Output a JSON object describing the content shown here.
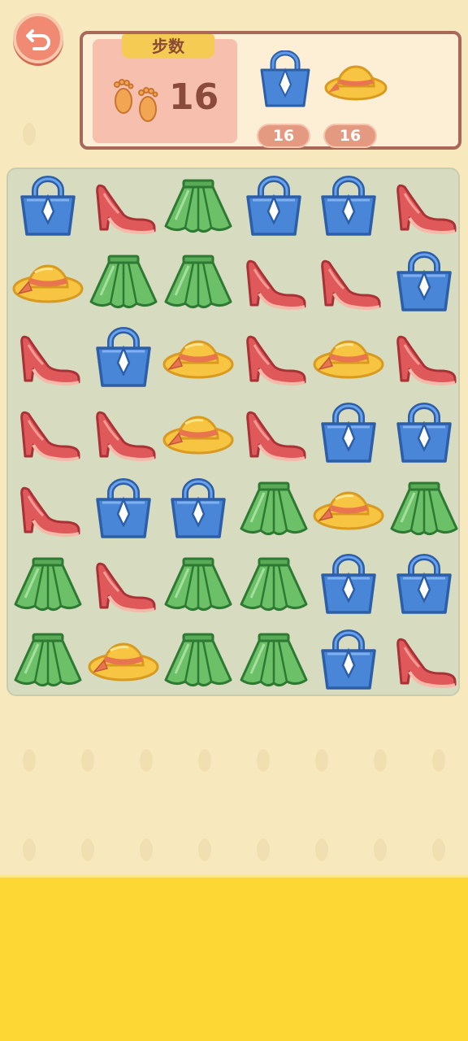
{
  "hud": {
    "steps_label": "步数",
    "steps_value": "16",
    "goals": [
      {
        "icon": "handbag-icon",
        "count": "16"
      },
      {
        "icon": "sun-hat-icon",
        "count": "16"
      }
    ]
  },
  "board": {
    "rows": 7,
    "cols": 6,
    "tiles": [
      [
        "bag",
        "heel",
        "skirt",
        "bag",
        "bag",
        "heel"
      ],
      [
        "hat",
        "skirt",
        "skirt",
        "heel",
        "heel",
        "bag"
      ],
      [
        "heel",
        "bag",
        "hat",
        "heel",
        "hat",
        "heel"
      ],
      [
        "heel",
        "heel",
        "hat",
        "heel",
        "bag",
        "bag"
      ],
      [
        "heel",
        "bag",
        "bag",
        "skirt",
        "hat",
        "skirt"
      ],
      [
        "skirt",
        "heel",
        "skirt",
        "skirt",
        "bag",
        "bag"
      ],
      [
        "skirt",
        "hat",
        "skirt",
        "skirt",
        "bag",
        "heel"
      ]
    ]
  },
  "colors": {
    "bag": "#4a86d8",
    "heel": "#e0595a",
    "skirt": "#6cc068",
    "hat": "#f5bd3a",
    "bottom_bar": "#fdd835"
  }
}
